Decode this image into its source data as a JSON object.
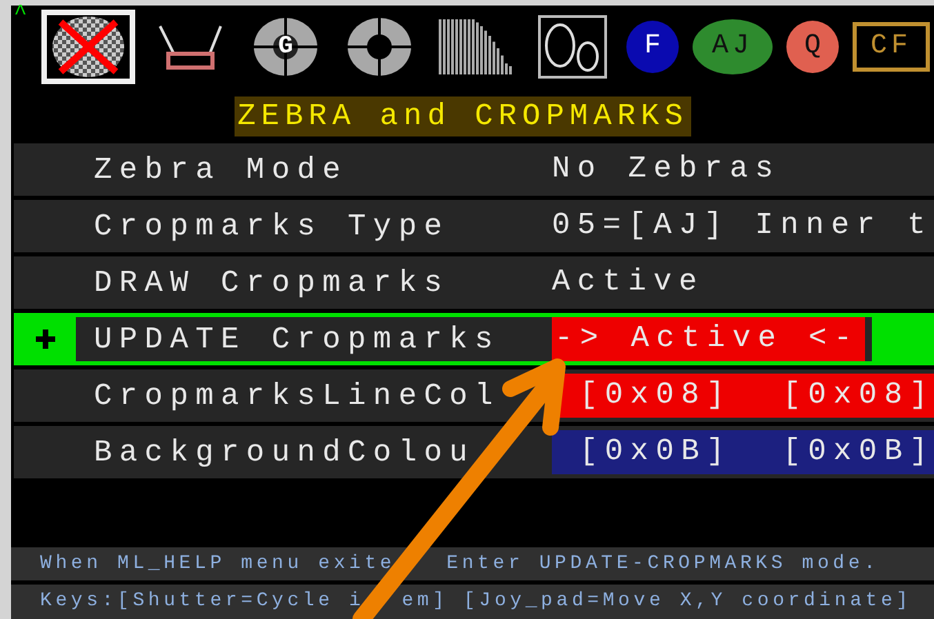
{
  "scroll_indicator": "^",
  "toolbar": [
    {
      "kind": "zebra",
      "selected": true
    },
    {
      "kind": "cropmarks",
      "selected": false
    },
    {
      "kind": "lens",
      "label": "G",
      "selected": false
    },
    {
      "kind": "ring",
      "selected": false
    },
    {
      "kind": "bars",
      "selected": false
    },
    {
      "kind": "scope",
      "selected": false
    },
    {
      "kind": "circle",
      "label": "F",
      "color": "#0a0ab0",
      "selected": false
    },
    {
      "kind": "pill",
      "label": "AJ",
      "color": "#2e8b2e",
      "selected": false
    },
    {
      "kind": "circle",
      "label": "Q",
      "color": "#e06050",
      "selected": false
    },
    {
      "kind": "frame",
      "label": "CF",
      "color": "#c09030",
      "selected": false
    }
  ],
  "title": "ZEBRA and CROPMARKS",
  "rows": [
    {
      "label": "Zebra Mode",
      "value": "No Zebras",
      "selected": false
    },
    {
      "label": "Cropmarks Type",
      "value": "05=[AJ] Inner t",
      "selected": false
    },
    {
      "label": "DRAW Cropmarks",
      "value": "Active",
      "selected": false
    },
    {
      "label": "UPDATE Cropmarks",
      "value": "-> Active <-",
      "color": "#ee0000",
      "selected": true
    },
    {
      "label": "CropmarksLineCol",
      "value": "[0x08]  [0x08]",
      "color": "#ee0000",
      "selected": false
    },
    {
      "label": "BackgroundColou",
      "value": "[0x0B]  [0x0B]",
      "color": "#1c2080",
      "selected": false
    }
  ],
  "help_line": [
    "When ML_HELP menu exite",
    "Enter UPDATE-CROPMARKS mode."
  ],
  "keys_line": [
    "Keys:[Shutter=Cycle i",
    "em] [Joy_pad=Move X,Y coordinate]"
  ]
}
